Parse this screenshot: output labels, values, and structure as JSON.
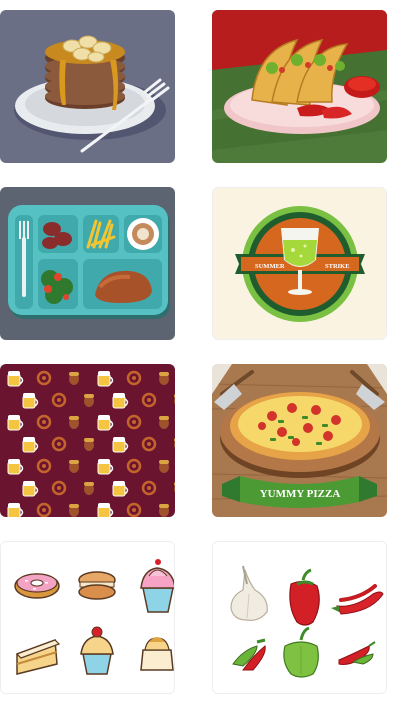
{
  "gallery": {
    "items": [
      {
        "icon": "pancake-stack-icon",
        "bg": "#6b6f86"
      },
      {
        "icon": "tacos-icon",
        "bg": "#4e7a3a"
      },
      {
        "icon": "lunch-tray-icon",
        "bg": "#5c6472"
      },
      {
        "icon": "drink-badge-icon",
        "bg": "#fbf3e2",
        "badge_left": "SUMMER",
        "badge_right": "STRIKE"
      },
      {
        "icon": "beer-pattern-icon",
        "bg": "#6b1430"
      },
      {
        "icon": "pizza-icon",
        "bg": "#a8784f",
        "banner": "YUMMY PIZZA"
      },
      {
        "icon": "desserts-icon",
        "bg": "#ffffff"
      },
      {
        "icon": "vegetables-icon",
        "bg": "#ffffff"
      }
    ]
  }
}
